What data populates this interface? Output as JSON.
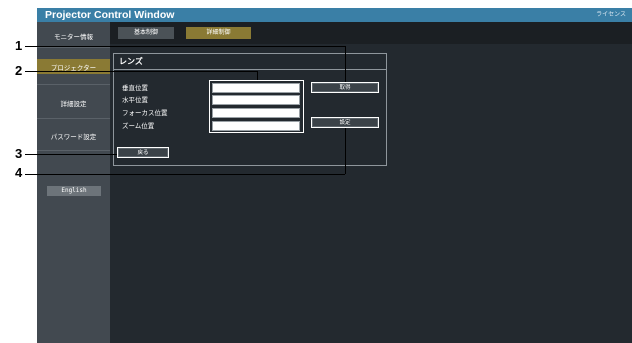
{
  "app": {
    "title": "Projector Control Window",
    "license_link": "ライセンス"
  },
  "tabs": [
    {
      "label": "基本制御",
      "active": false
    },
    {
      "label": "詳細制御",
      "active": true
    }
  ],
  "sidebar": {
    "items": [
      {
        "label": "モニター情報"
      },
      {
        "label": "プロジェクター"
      },
      {
        "label": "詳細設定"
      },
      {
        "label": "パスワード設定"
      }
    ],
    "language_button": "English"
  },
  "content": {
    "title": "レンズ",
    "fields": [
      {
        "label": "垂直位置",
        "value": ""
      },
      {
        "label": "水平位置",
        "value": ""
      },
      {
        "label": "フォーカス位置",
        "value": ""
      },
      {
        "label": "ズーム位置",
        "value": ""
      }
    ],
    "buttons": {
      "get": "取得",
      "set": "設定",
      "back": "戻る"
    }
  },
  "callouts": [
    "1",
    "2",
    "3",
    "4"
  ],
  "colors": {
    "title_bar": "#3a7fa6",
    "accent": "#8a7a34",
    "background": "#23292f"
  }
}
